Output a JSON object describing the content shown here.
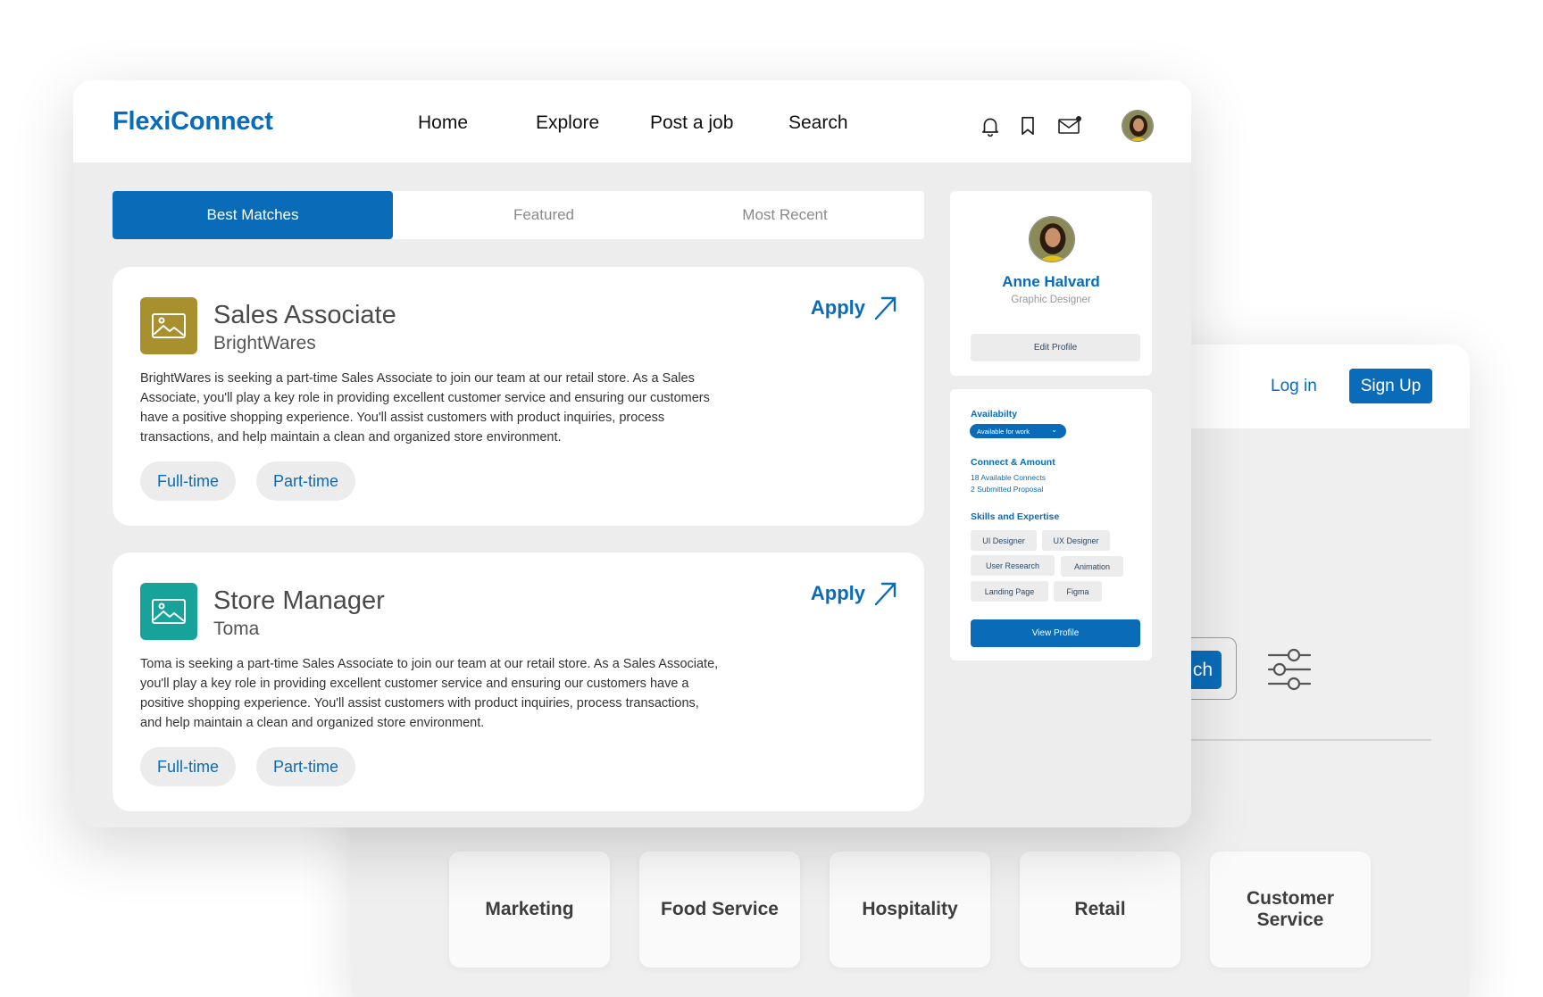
{
  "colors": {
    "brand": "#0a6cb8",
    "logo_sales": "#a8902e",
    "logo_store": "#17a39a"
  },
  "back": {
    "login": "Log in",
    "signup": "Sign Up",
    "search_fragment": "ch",
    "categories": [
      "Marketing",
      "Food Service",
      "Hospitality",
      "Retail",
      "Customer Service"
    ]
  },
  "header": {
    "brand": "FlexiConnect",
    "nav": [
      "Home",
      "Explore",
      "Post a job",
      "Search"
    ],
    "icons": [
      "bell-icon",
      "bookmark-icon",
      "mail-icon"
    ]
  },
  "tabs": [
    "Best Matches",
    "Featured",
    "Most Recent"
  ],
  "jobs": [
    {
      "title": "Sales Associate",
      "company": "BrightWares",
      "apply": "Apply",
      "description": "BrightWares is seeking a part-time Sales Associate to join our team at our retail store. As a Sales Associate, you'll play a key role in providing excellent customer service and ensuring our customers have a positive shopping experience. You'll assist customers with product inquiries, process transactions, and help maintain a clean and organized store environment.",
      "tags": [
        "Full-time",
        "Part-time"
      ]
    },
    {
      "title": "Store Manager",
      "company": "Toma",
      "apply": "Apply",
      "description": "Toma is seeking a part-time Sales Associate to join our team at our retail store. As a Sales Associate, you'll play a key role in providing excellent customer service and ensuring our customers have a positive shopping experience. You'll assist customers with product inquiries, process transactions, and help maintain a clean and organized store environment.",
      "tags": [
        "Full-time",
        "Part-time"
      ]
    }
  ],
  "profile": {
    "name": "Anne Halvard",
    "role": "Graphic Designer",
    "edit": "Edit Profile",
    "availability_title": "Availabilty",
    "availability_value": "Available for work",
    "connect_title": "Connect & Amount",
    "connects": "18 Available Connects",
    "proposals": "2 Submitted Proposal",
    "skills_title": "Skills and Expertise",
    "skills": [
      "UI Designer",
      "UX Designer",
      "User Research",
      "Animation",
      "Landing Page",
      "Figma"
    ],
    "view": "View Profile"
  }
}
